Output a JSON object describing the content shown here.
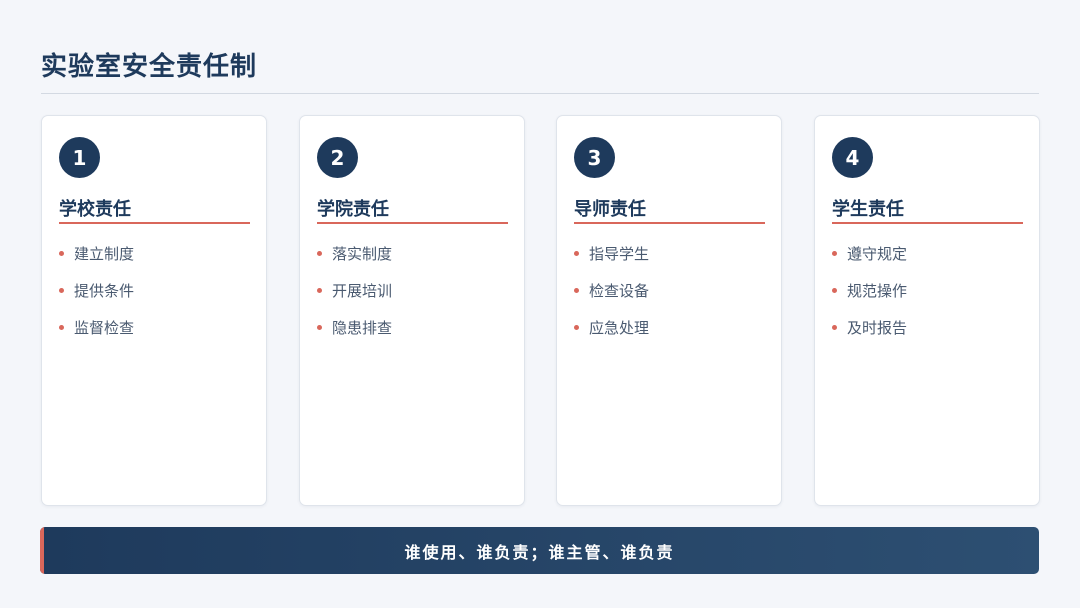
{
  "page": {
    "title": "实验室安全责任制"
  },
  "cards": [
    {
      "number": "1",
      "title": "学校责任",
      "items": [
        "建立制度",
        "提供条件",
        "监督检查"
      ]
    },
    {
      "number": "2",
      "title": "学院责任",
      "items": [
        "落实制度",
        "开展培训",
        "隐患排查"
      ]
    },
    {
      "number": "3",
      "title": "导师责任",
      "items": [
        "指导学生",
        "检查设备",
        "应急处理"
      ]
    },
    {
      "number": "4",
      "title": "学生责任",
      "items": [
        "遵守规定",
        "规范操作",
        "及时报告"
      ]
    }
  ],
  "footer": {
    "text": "谁使用、谁负责；谁主管、谁负责"
  },
  "colors": {
    "primary": "#1e3a5c",
    "accent": "#d9675b",
    "background": "#f4f6fa",
    "card": "#ffffff",
    "bullet_text": "#4a5a70"
  }
}
